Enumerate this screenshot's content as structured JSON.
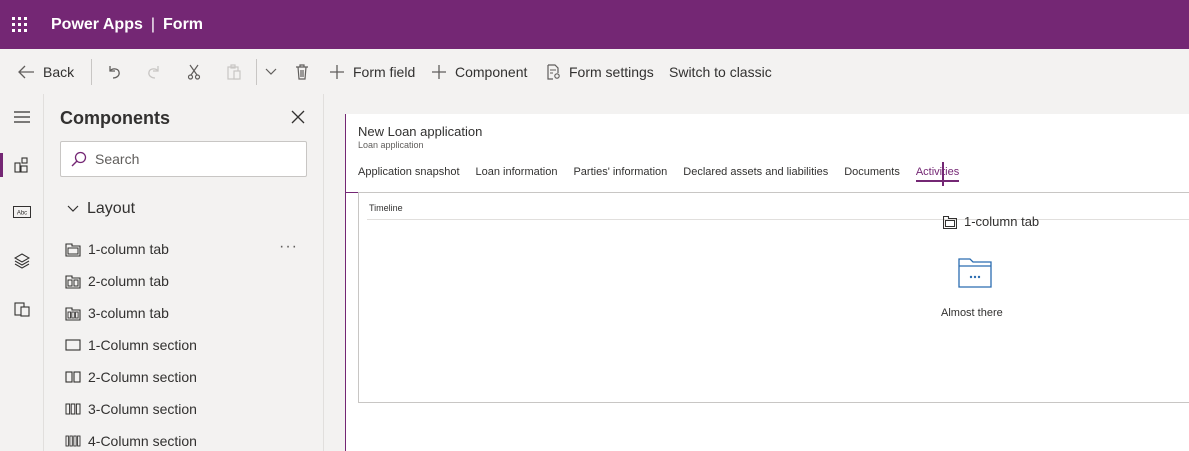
{
  "header": {
    "app_name": "Power Apps",
    "separator": "|",
    "page": "Form",
    "bg_color": "#742774"
  },
  "toolbar": {
    "back": "Back",
    "form_field": "Form field",
    "component": "Component",
    "form_settings": "Form settings",
    "switch_classic": "Switch to classic"
  },
  "rail": {
    "icons": [
      "hamburger-icon",
      "components-icon",
      "text-field-icon",
      "layers-icon",
      "form-library-icon"
    ]
  },
  "components_panel": {
    "title": "Components",
    "search_placeholder": "Search",
    "layout_group": "Layout",
    "more": "···",
    "items": [
      {
        "label": "1-column tab",
        "icon": "one-column-tab-icon"
      },
      {
        "label": "2-column tab",
        "icon": "two-column-tab-icon"
      },
      {
        "label": "3-column tab",
        "icon": "three-column-tab-icon"
      },
      {
        "label": "1-Column section",
        "icon": "one-column-section-icon"
      },
      {
        "label": "2-Column section",
        "icon": "two-column-section-icon"
      },
      {
        "label": "3-Column section",
        "icon": "three-column-section-icon"
      },
      {
        "label": "4-Column section",
        "icon": "four-column-section-icon"
      }
    ]
  },
  "form": {
    "title": "New Loan application",
    "subtitle": "Loan application",
    "tabs": [
      {
        "label": "Application snapshot"
      },
      {
        "label": "Loan information"
      },
      {
        "label": "Parties' information"
      },
      {
        "label": "Declared assets and liabilities"
      },
      {
        "label": "Documents"
      },
      {
        "label": "Activities"
      }
    ],
    "active_tab": "Activities",
    "section_label": "Timeline",
    "empty_state": "Almost there",
    "drag_label": "1-column tab"
  }
}
